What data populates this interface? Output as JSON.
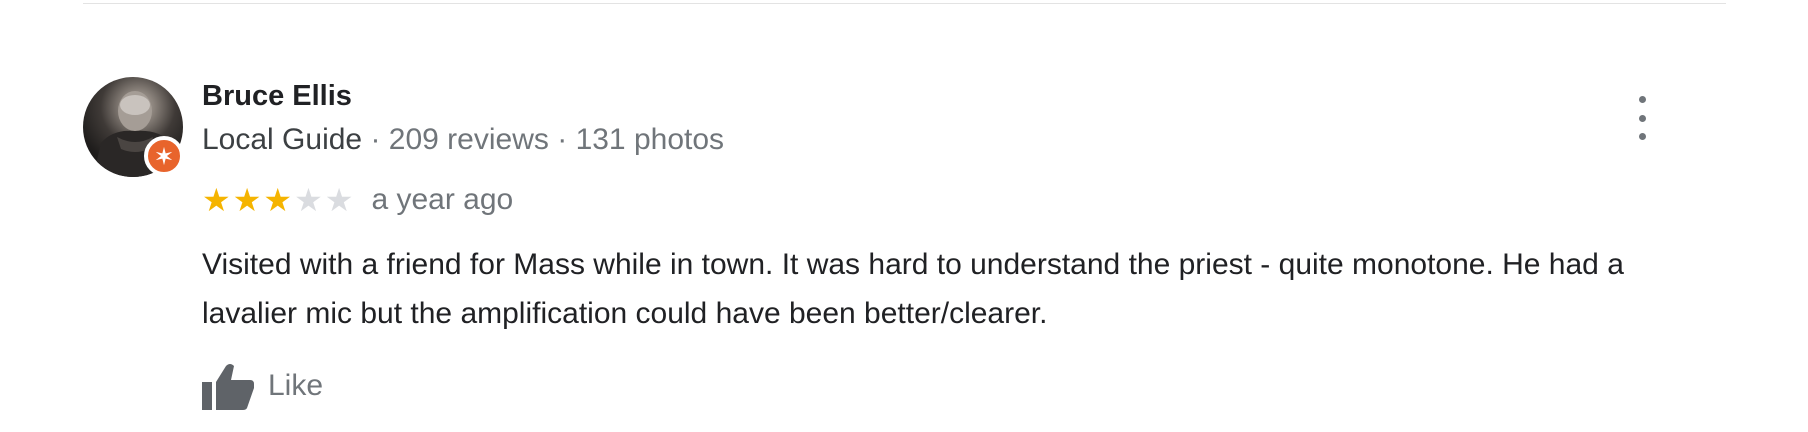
{
  "review": {
    "reviewer_name": "Bruce Ellis",
    "reviewer_badge": "Local Guide",
    "review_count": "209 reviews",
    "photo_count": "131 photos",
    "separator": "·",
    "rating": 3,
    "rating_max": 5,
    "date": "a year ago",
    "text": "Visited with a friend for Mass while in town. It was hard to understand the priest - quite monotone. He had a lavalier mic but the amplification could have been better/clearer.",
    "like_label": "Like"
  },
  "icons": {
    "avatar": "avatar",
    "badge": "local-guide-badge-icon",
    "more": "more-vert-icon",
    "like": "thumb-up-icon",
    "star": "star-icon"
  },
  "colors": {
    "star_filled": "#f5b400",
    "star_empty": "#dadce0",
    "badge": "#e8642c",
    "primary_text": "#202124",
    "secondary_text": "#70757a"
  }
}
